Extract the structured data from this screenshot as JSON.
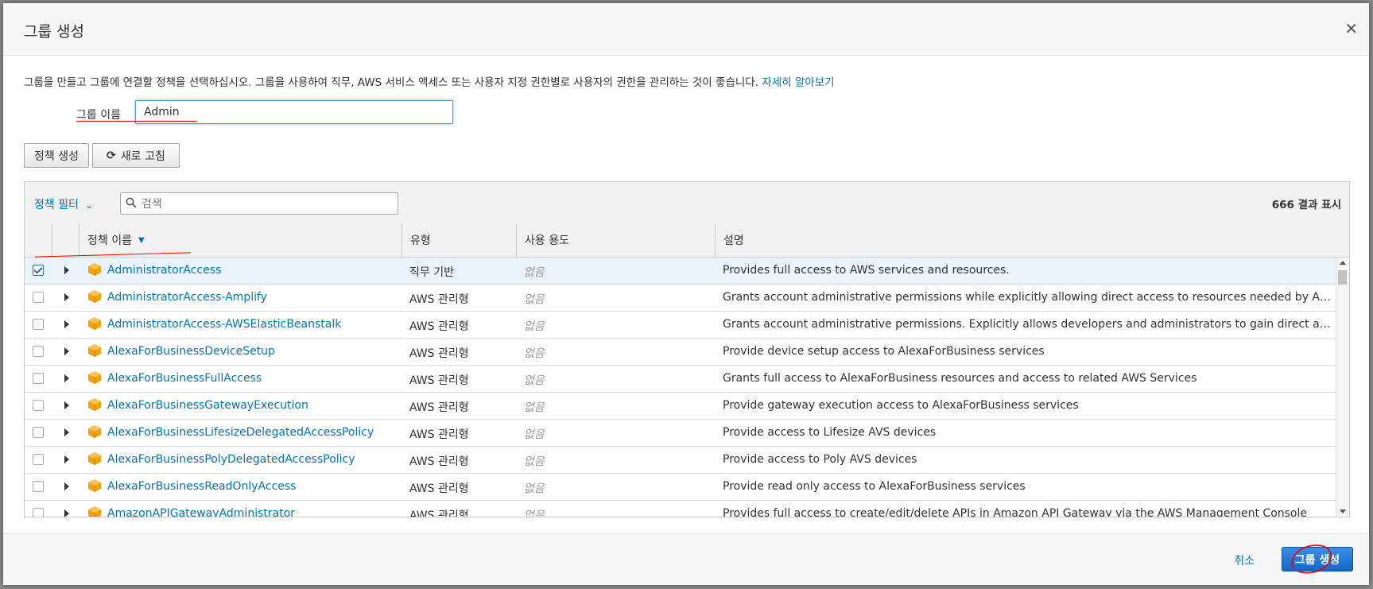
{
  "dialog": {
    "title": "그룹 생성",
    "intro_text": "그룹을 만들고 그룹에 연결할 정책을 선택하십시오. 그룹을 사용하여 직무, AWS 서비스 액세스 또는 사용자 지정 권한별로 사용자의 권한을 관리하는 것이 좋습니다.",
    "learn_more": "자세히 알아보기",
    "group_name_label": "그룹 이름",
    "group_name_value": "Admin"
  },
  "toolbar": {
    "create_policy": "정책 생성",
    "refresh": "새로 고침"
  },
  "filter": {
    "label": "정책 필터",
    "search_placeholder": "검색",
    "result_count": "666 결과 표시"
  },
  "table": {
    "columns": [
      "정책 이름",
      "유형",
      "사용 용도",
      "설명"
    ],
    "rows": [
      {
        "name": "AdministratorAccess",
        "type": "직무 기반",
        "usage": "없음",
        "desc": "Provides full access to AWS services and resources.",
        "checked": true
      },
      {
        "name": "AdministratorAccess-Amplify",
        "type": "AWS 관리형",
        "usage": "없음",
        "desc": "Grants account administrative permissions while explicitly allowing direct access to resources needed by Amplify applicat...",
        "checked": false
      },
      {
        "name": "AdministratorAccess-AWSElasticBeanstalk",
        "type": "AWS 관리형",
        "usage": "없음",
        "desc": "Grants account administrative permissions. Explicitly allows developers and administrators to gain direct access to resou...",
        "checked": false
      },
      {
        "name": "AlexaForBusinessDeviceSetup",
        "type": "AWS 관리형",
        "usage": "없음",
        "desc": "Provide device setup access to AlexaForBusiness services",
        "checked": false
      },
      {
        "name": "AlexaForBusinessFullAccess",
        "type": "AWS 관리형",
        "usage": "없음",
        "desc": "Grants full access to AlexaForBusiness resources and access to related AWS Services",
        "checked": false
      },
      {
        "name": "AlexaForBusinessGatewayExecution",
        "type": "AWS 관리형",
        "usage": "없음",
        "desc": "Provide gateway execution access to AlexaForBusiness services",
        "checked": false
      },
      {
        "name": "AlexaForBusinessLifesizeDelegatedAccessPolicy",
        "type": "AWS 관리형",
        "usage": "없음",
        "desc": "Provide access to Lifesize AVS devices",
        "checked": false
      },
      {
        "name": "AlexaForBusinessPolyDelegatedAccessPolicy",
        "type": "AWS 관리형",
        "usage": "없음",
        "desc": "Provide access to Poly AVS devices",
        "checked": false
      },
      {
        "name": "AlexaForBusinessReadOnlyAccess",
        "type": "AWS 관리형",
        "usage": "없음",
        "desc": "Provide read only access to AlexaForBusiness services",
        "checked": false
      },
      {
        "name": "AmazonAPIGatewayAdministrator",
        "type": "AWS 관리형",
        "usage": "없음",
        "desc": "Provides full access to create/edit/delete APIs in Amazon API Gateway via the AWS Management Console",
        "checked": false
      }
    ]
  },
  "footer": {
    "cancel": "취소",
    "create_group": "그룹 생성"
  },
  "colors": {
    "link": "#0073bb",
    "primary": "#1466c6",
    "policy_icon": "#f0a30a",
    "annotation": "#e00000"
  }
}
